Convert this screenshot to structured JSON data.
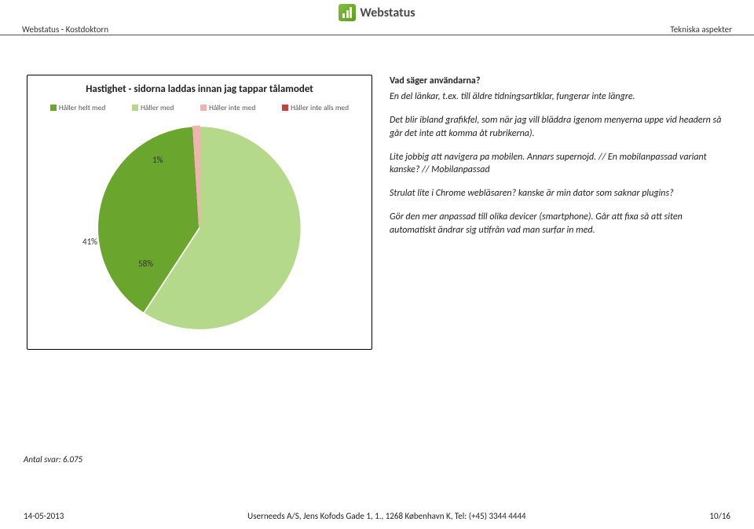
{
  "logo_text": "Webstatus",
  "meta": {
    "left": "Webstatus - Kostdoktorn",
    "right": "Tekniska aspekter"
  },
  "chart_data": {
    "type": "pie",
    "title": "Hastighet - sidorna laddas innan jag tappar tålamodet",
    "series": [
      {
        "name": "Håller helt med",
        "value": 41,
        "color": "#6aa52d"
      },
      {
        "name": "Håller med",
        "value": 58,
        "color": "#b5d98a"
      },
      {
        "name": "Håller inte med",
        "value": 1,
        "color": "#f2b2b2"
      },
      {
        "name": "Håller inte alls med",
        "value": 0,
        "color": "#c94040"
      }
    ]
  },
  "legend": [
    {
      "label": "Håller helt med",
      "color": "#6aa52d"
    },
    {
      "label": "Håller med",
      "color": "#b5d98a"
    },
    {
      "label": "Håller inte med",
      "color": "#f2b2b2"
    },
    {
      "label": "Håller inte alls med",
      "color": "#c94040"
    }
  ],
  "pie_labels": {
    "l58": "58%",
    "l41": "41%",
    "l1": "1%"
  },
  "comments": {
    "heading": "Vad säger användarna?",
    "p1": "En del länkar, t.ex. till äldre tidningsartiklar, fungerar inte längre.",
    "p2": "Det blir ibland grafikfel, som när jag vill bläddra igenom menyerna uppe vid headern så går det inte att komma åt rubrikerna).",
    "p3": "Lite jobbig att navigera pa mobilen. Annars supernojd. // En mobilanpassad variant kanske? // Mobilanpassad",
    "p4": "Strulat lite i Chrome webläsaren? kanske är min dator som saknar plugins?",
    "p5": "Gör den mer anpassad till olika devicer (smartphone). Går att fixa så att siten automatiskt ändrar sig utifrån vad man surfar in med."
  },
  "answers_note": "Antal svar: 6.075",
  "footer": {
    "date": "14-05-2013",
    "center": "Userneeds A/S, Jens Kofods Gade 1, 1., 1268 København K, Tel: (+45) 3344 4444",
    "page": "10/16"
  }
}
